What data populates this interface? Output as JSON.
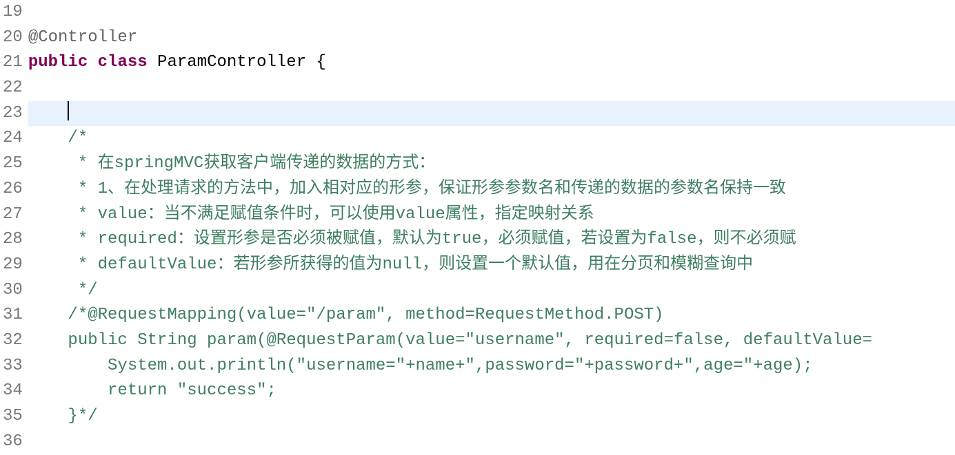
{
  "gutter": {
    "lines": [
      "19",
      "20",
      "21",
      "22",
      "23",
      "24",
      "25",
      "26",
      "27",
      "28",
      "29",
      "30",
      "31",
      "32",
      "33",
      "34",
      "35",
      "36"
    ]
  },
  "code": {
    "line19": "",
    "line20_annotation": "@Controller",
    "line21_public": "public",
    "line21_class": "class",
    "line21_classname": " ParamController ",
    "line21_brace": "{",
    "line22": "",
    "line23_indent": "    ",
    "line24": "    /*",
    "line25": "     * 在springMVC获取客户端传递的数据的方式：",
    "line26": "     * 1、在处理请求的方法中，加入相对应的形参，保证形参参数名和传递的数据的参数名保持一致",
    "line27": "     * value：当不满足赋值条件时，可以使用value属性，指定映射关系",
    "line28": "     * required：设置形参是否必须被赋值，默认为true，必须赋值，若设置为false，则不必须赋",
    "line29": "     * defaultValue：若形参所获得的值为null，则设置一个默认值，用在分页和模糊查询中",
    "line30": "     */",
    "line31": "    /*@RequestMapping(value=\"/param\", method=RequestMethod.POST)",
    "line32": "    public String param(@RequestParam(value=\"username\", required=false, defaultValue=",
    "line33": "        System.out.println(\"username=\"+name+\",password=\"+password+\",age=\"+age);",
    "line34": "        return \"success\";",
    "line35": "    }*/",
    "line36": ""
  },
  "folding": {
    "line24_marker": "⊖",
    "line31_marker": "⊖"
  }
}
